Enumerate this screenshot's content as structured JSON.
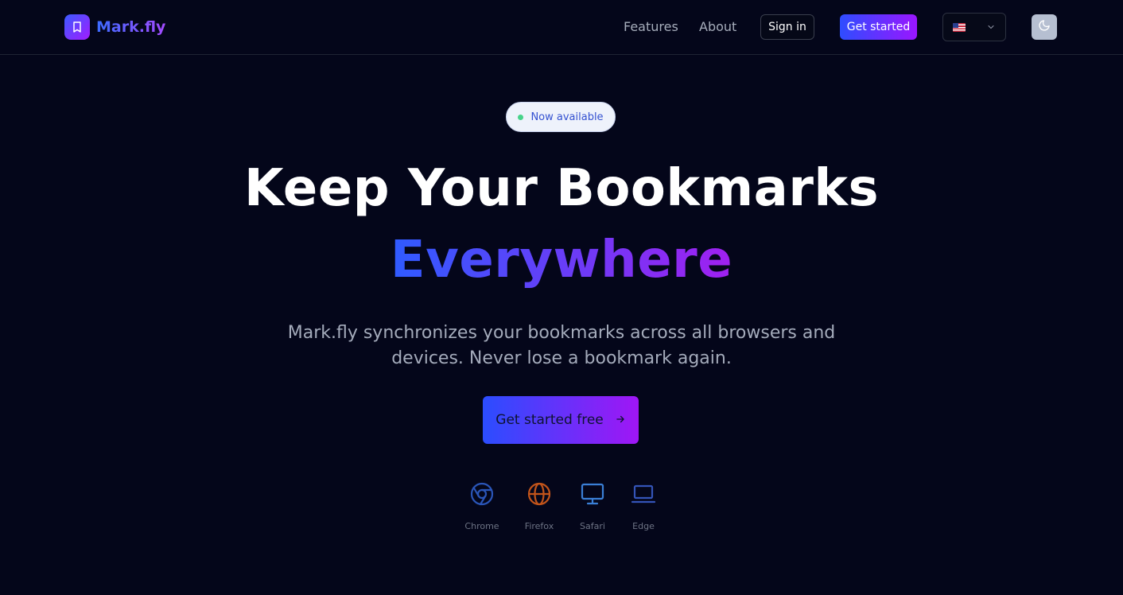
{
  "brand": {
    "name": "Mark.fly",
    "logo_icon": "bookmark-icon"
  },
  "nav": {
    "links": [
      "Features",
      "About"
    ],
    "signin_label": "Sign in",
    "get_started_label": "Get started",
    "language": {
      "flag": "us-flag-icon",
      "dropdown_icon": "chevron-down-icon"
    },
    "theme_icon": "moon-icon"
  },
  "hero": {
    "badge": "Now available",
    "title_line1": "Keep Your Bookmarks",
    "title_line2": "Everywhere",
    "subtitle": "Mark.fly synchronizes your bookmarks across all browsers and devices. Never lose a bookmark again.",
    "cta_label": "Get started free",
    "cta_icon": "arrow-right-icon"
  },
  "browsers": [
    {
      "label": "Chrome",
      "icon": "chrome-icon",
      "color": "#2a55b8"
    },
    {
      "label": "Firefox",
      "icon": "globe-icon",
      "color": "#c2541a"
    },
    {
      "label": "Safari",
      "icon": "monitor-icon",
      "color": "#3a7fd6"
    },
    {
      "label": "Edge",
      "icon": "laptop-icon",
      "color": "#3454b8"
    }
  ],
  "colors": {
    "background": "#04061a",
    "accent_start": "#2b4dff",
    "accent_end": "#a016f5",
    "badge_dot": "#47d38a"
  }
}
